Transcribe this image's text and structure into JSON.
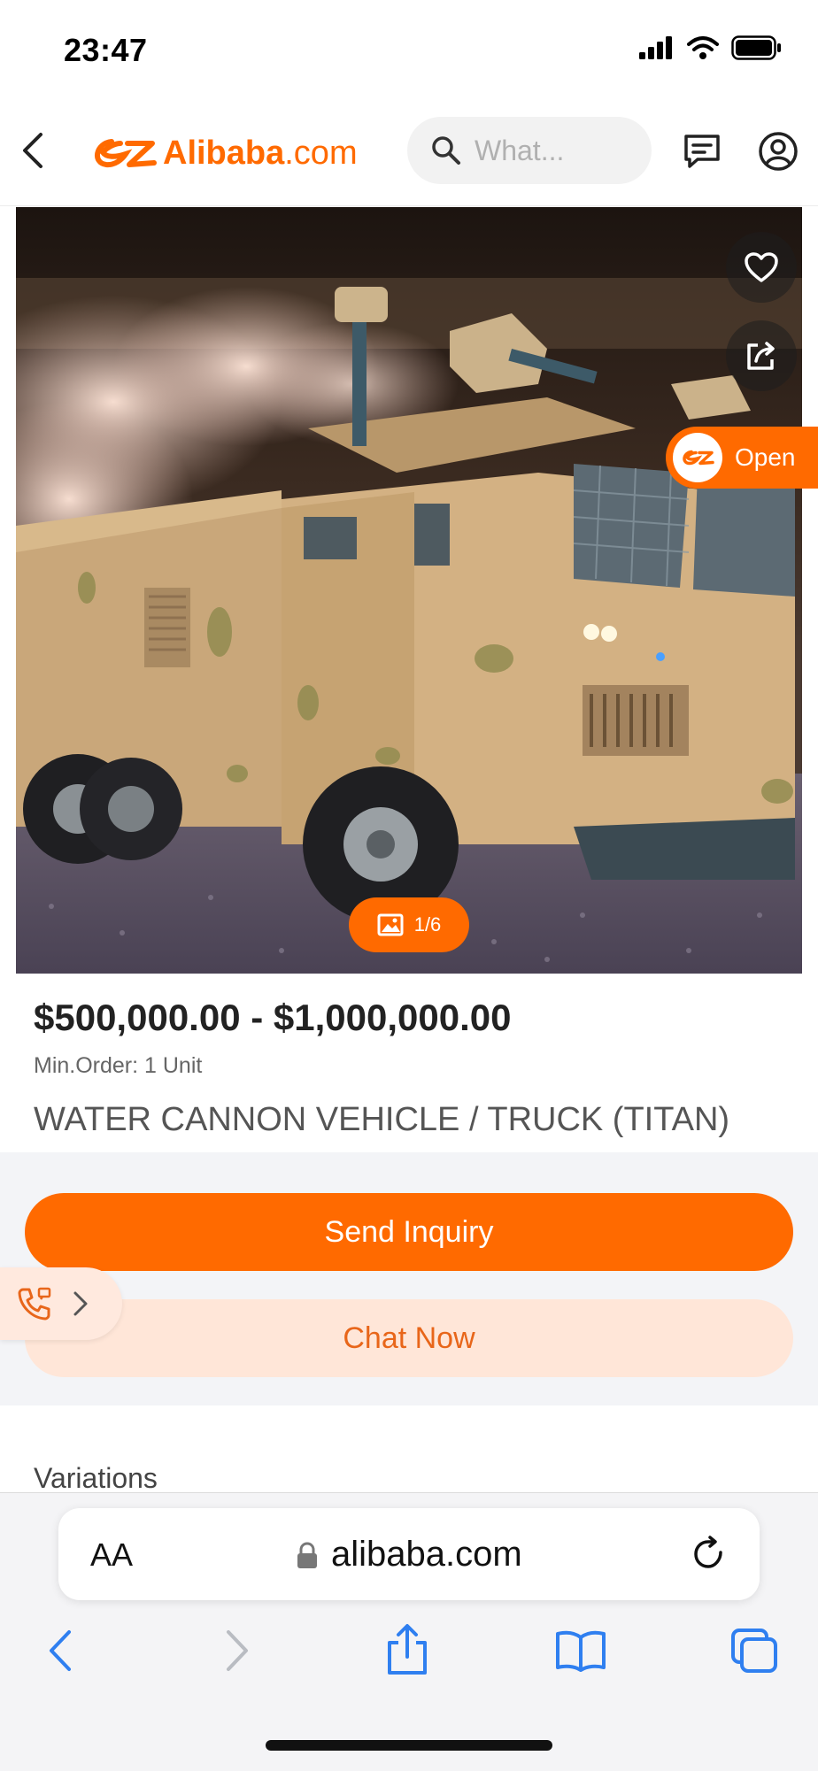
{
  "status_bar": {
    "time": "23:47"
  },
  "header": {
    "logo_text": "Alibaba",
    "logo_suffix": ".com",
    "search_placeholder": "What..."
  },
  "gallery": {
    "counter": "1/6",
    "open_label": "Open"
  },
  "product": {
    "price": "$500,000.00 - $1,000,000.00",
    "min_order": "Min.Order: 1 Unit",
    "title": "WATER CANNON VEHICLE / TRUCK (TITAN)"
  },
  "actions": {
    "inquiry_label": "Send Inquiry",
    "chat_label": "Chat Now"
  },
  "sections": {
    "variations_label": "Variations"
  },
  "browser": {
    "aa_label": "AA",
    "url": "alibaba.com"
  },
  "colors": {
    "brand": "#ff6a00",
    "chat_bg": "#ffe6d8",
    "ios_blue": "#2f7ff0"
  }
}
